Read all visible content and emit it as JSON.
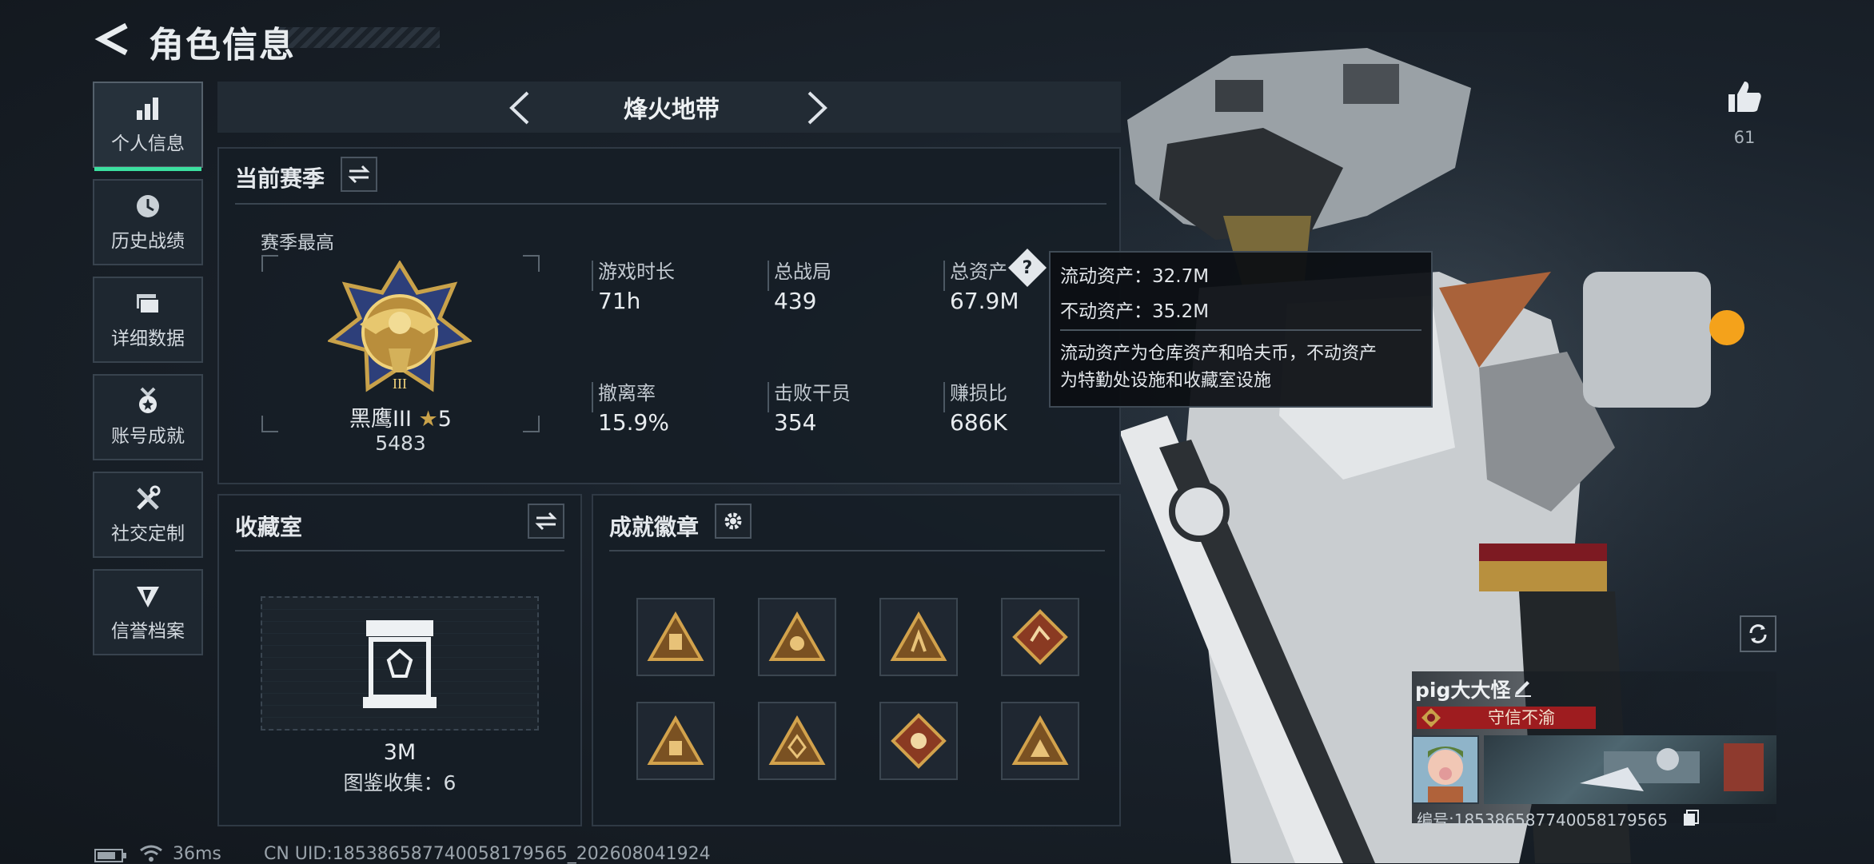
{
  "header": {
    "title": "角色信息"
  },
  "sidebar": {
    "items": [
      {
        "label": "个人信息",
        "icon": "bar-chart-icon",
        "active": true
      },
      {
        "label": "历史战绩",
        "icon": "history-clock-icon"
      },
      {
        "label": "详细数据",
        "icon": "folder-icon"
      },
      {
        "label": "账号成就",
        "icon": "medal-icon"
      },
      {
        "label": "社交定制",
        "icon": "tools-icon"
      },
      {
        "label": "信誉档案",
        "icon": "shield-badge-icon"
      }
    ]
  },
  "mode": {
    "name": "烽火地带"
  },
  "season": {
    "title": "当前赛季",
    "best_label": "赛季最高",
    "rank_name": "黑鹰III",
    "rank_stars": "5",
    "rank_score": "5483",
    "stats": [
      {
        "label": "游戏时长",
        "value": "71h"
      },
      {
        "label": "总战局",
        "value": "439"
      },
      {
        "label": "总资产",
        "value": "67.9M"
      },
      {
        "label": "撤离率",
        "value": "15.9%"
      },
      {
        "label": "击败干员",
        "value": "354"
      },
      {
        "label": "赚损比",
        "value": "686K"
      }
    ]
  },
  "tooltip": {
    "liquid": "流动资产：32.7M",
    "fixed": "不动资产：35.2M",
    "desc_line1": "流动资产为仓库资产和哈夫币，不动资产",
    "desc_line2": "为特勤处设施和收藏室设施"
  },
  "collection": {
    "title": "收藏室",
    "value": "3M",
    "count_label": "图鉴收集：6"
  },
  "achievements": {
    "title": "成就徽章"
  },
  "likes": {
    "count": "61"
  },
  "player": {
    "name": "pig大大怪",
    "title_badge": "守信不渝",
    "id_label": "编号:185386587740058179565"
  },
  "status_bar": {
    "ping": "36ms",
    "uid": "CN UID:185386587740058179565_202608041924"
  },
  "colors": {
    "accent": "#3be0a0",
    "title_badge_bg": "#9e1c1f",
    "gold": "#c9a24a"
  }
}
